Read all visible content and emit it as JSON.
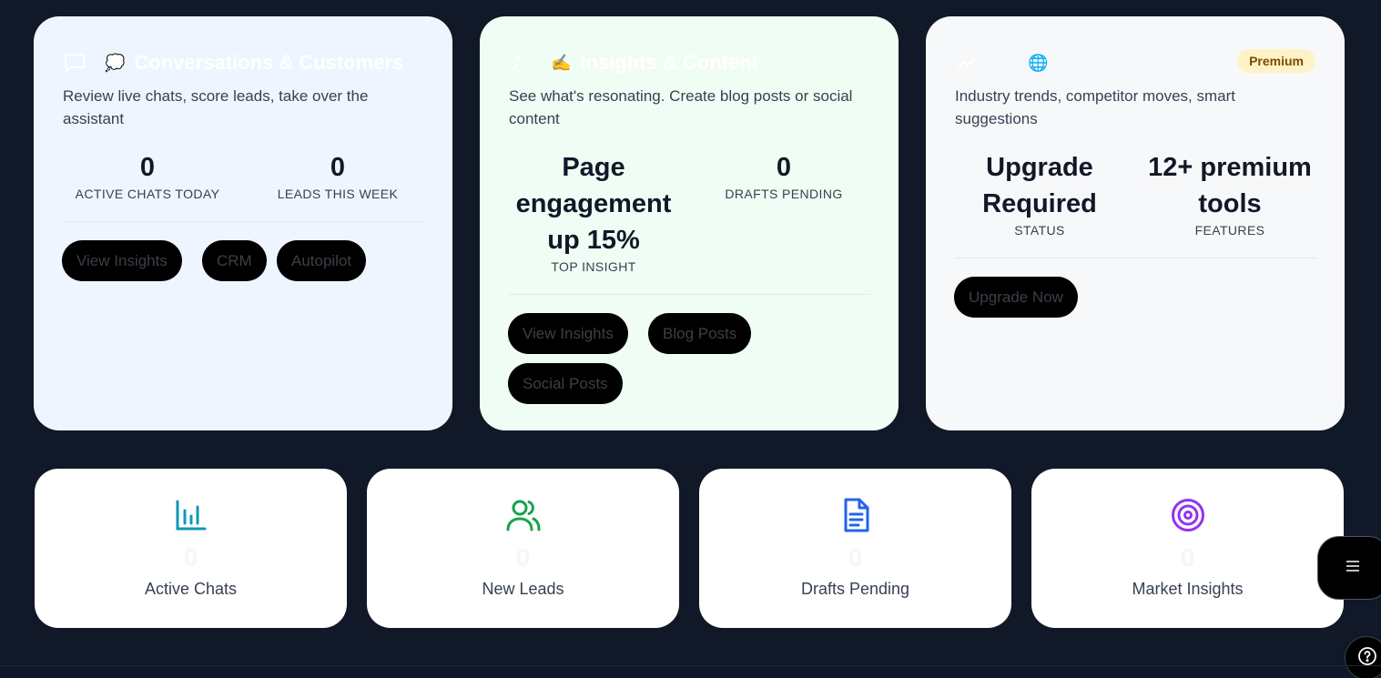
{
  "cards": [
    {
      "title": "Conversations & Customers",
      "emoji": "💭",
      "description": "Review live chats, score leads, take over the assistant",
      "stats": [
        {
          "value": "0",
          "label": "ACTIVE CHATS TODAY"
        },
        {
          "value": "0",
          "label": "LEADS THIS WEEK"
        }
      ],
      "buttons": [
        "View Insights",
        "CRM",
        "Autopilot"
      ]
    },
    {
      "title": "Insights & Content",
      "emoji": "✍️",
      "description": "See what's resonating. Create blog posts or social content",
      "stats": [
        {
          "value": "Page engagement up 15%",
          "label": "TOP INSIGHT"
        },
        {
          "value": "0",
          "label": "DRAFTS PENDING"
        }
      ],
      "buttons": [
        "View Insights",
        "Blog Posts",
        "Social Posts"
      ]
    },
    {
      "title": "",
      "emoji": "🌐",
      "badge": "Premium",
      "description": "Industry trends, competitor moves, smart suggestions",
      "stats": [
        {
          "value": "Upgrade Required",
          "label": "STATUS"
        },
        {
          "value": "12+ premium tools",
          "label": "FEATURES"
        }
      ],
      "buttons": [
        "Upgrade Now"
      ]
    }
  ],
  "tiles": [
    {
      "label": "Active Chats",
      "value": "0",
      "icon": "bar-chart-icon",
      "color": "#0e9ab3"
    },
    {
      "label": "New Leads",
      "value": "0",
      "icon": "users-icon",
      "color": "#16a34a"
    },
    {
      "label": "Drafts Pending",
      "value": "0",
      "icon": "document-icon",
      "color": "#2563eb"
    },
    {
      "label": "Market Insights",
      "value": "0",
      "icon": "target-icon",
      "color": "#9333ea"
    }
  ],
  "floating": {
    "menu_icon": "menu-icon",
    "help_icon": "help-icon"
  },
  "colors": {
    "background": "#111827",
    "card1_bg": "#eff5ff",
    "card2_bg": "#f0fdf4",
    "card3_bg": "#f7f8fa",
    "button_bg": "#000000",
    "premium_badge_bg": "#fef3c7"
  }
}
